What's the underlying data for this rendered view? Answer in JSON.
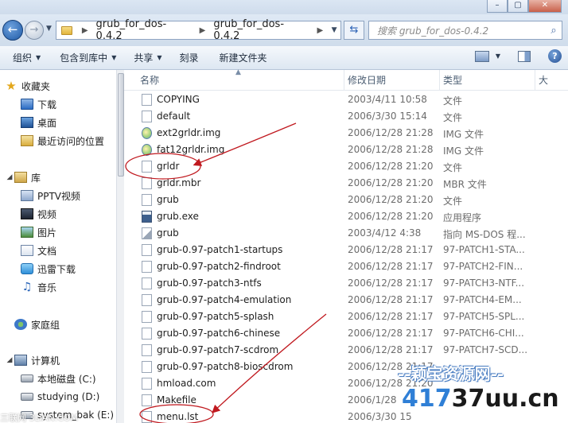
{
  "address": {
    "crumbs": [
      "grub_for_dos-0.4.2",
      "grub_for_dos-0.4.2"
    ],
    "search_placeholder": "搜索 grub_for_dos-0.4.2"
  },
  "toolbar": {
    "organize": "组织",
    "include_in_library": "包含到库中",
    "share": "共享",
    "burn": "刻录",
    "new_folder": "新建文件夹"
  },
  "nav": {
    "favorites": "收藏夹",
    "downloads": "下载",
    "desktop": "桌面",
    "recent": "最近访问的位置",
    "library": "库",
    "pptv": "PPTV视频",
    "videos": "视频",
    "pictures": "图片",
    "documents": "文档",
    "thunder": "迅雷下载",
    "music": "音乐",
    "homegroup": "家庭组",
    "computer": "计算机",
    "drive_c": "本地磁盘 (C:)",
    "drive_d": "studying (D:)",
    "drive_e": "system_bak (E:)"
  },
  "columns": {
    "name": "名称",
    "date": "修改日期",
    "type": "类型",
    "size": "大"
  },
  "files": [
    {
      "name": "COPYING",
      "date": "2003/4/11 10:58",
      "type": "文件",
      "icon": "file"
    },
    {
      "name": "default",
      "date": "2006/3/30 15:14",
      "type": "文件",
      "icon": "file"
    },
    {
      "name": "ext2grldr.img",
      "date": "2006/12/28 21:28",
      "type": "IMG 文件",
      "icon": "img"
    },
    {
      "name": "fat12grldr.img",
      "date": "2006/12/28 21:28",
      "type": "IMG 文件",
      "icon": "img"
    },
    {
      "name": "grldr",
      "date": "2006/12/28 21:20",
      "type": "文件",
      "icon": "file"
    },
    {
      "name": "grldr.mbr",
      "date": "2006/12/28 21:20",
      "type": "MBR 文件",
      "icon": "file"
    },
    {
      "name": "grub",
      "date": "2006/12/28 21:20",
      "type": "文件",
      "icon": "file"
    },
    {
      "name": "grub.exe",
      "date": "2006/12/28 21:20",
      "type": "应用程序",
      "icon": "exe"
    },
    {
      "name": "grub",
      "date": "2003/4/12 4:38",
      "type": "指向 MS-DOS 程...",
      "icon": "lnk"
    },
    {
      "name": "grub-0.97-patch1-startups",
      "date": "2006/12/28 21:17",
      "type": "97-PATCH1-STA...",
      "icon": "file"
    },
    {
      "name": "grub-0.97-patch2-findroot",
      "date": "2006/12/28 21:17",
      "type": "97-PATCH2-FIN...",
      "icon": "file"
    },
    {
      "name": "grub-0.97-patch3-ntfs",
      "date": "2006/12/28 21:17",
      "type": "97-PATCH3-NTF...",
      "icon": "file"
    },
    {
      "name": "grub-0.97-patch4-emulation",
      "date": "2006/12/28 21:17",
      "type": "97-PATCH4-EM...",
      "icon": "file"
    },
    {
      "name": "grub-0.97-patch5-splash",
      "date": "2006/12/28 21:17",
      "type": "97-PATCH5-SPL...",
      "icon": "file"
    },
    {
      "name": "grub-0.97-patch6-chinese",
      "date": "2006/12/28 21:17",
      "type": "97-PATCH6-CHI...",
      "icon": "file"
    },
    {
      "name": "grub-0.97-patch7-scdrom",
      "date": "2006/12/28 21:17",
      "type": "97-PATCH7-SCD...",
      "icon": "file"
    },
    {
      "name": "grub-0.97-patch8-bioscdrom",
      "date": "2006/12/28 21:17",
      "type": "",
      "icon": "file"
    },
    {
      "name": "hmload.com",
      "date": "2006/12/28 21:20",
      "type": "",
      "icon": "file"
    },
    {
      "name": "Makefile",
      "date": "2006/1/28",
      "type": "",
      "icon": "file"
    },
    {
      "name": "menu.lst",
      "date": "2006/3/30 15",
      "type": "",
      "icon": "file"
    }
  ],
  "watermark": {
    "top": "--颖宝资源网--",
    "blue": "417",
    "black": "37uu.cn",
    "left": "三联网 3LIAN.COM"
  }
}
